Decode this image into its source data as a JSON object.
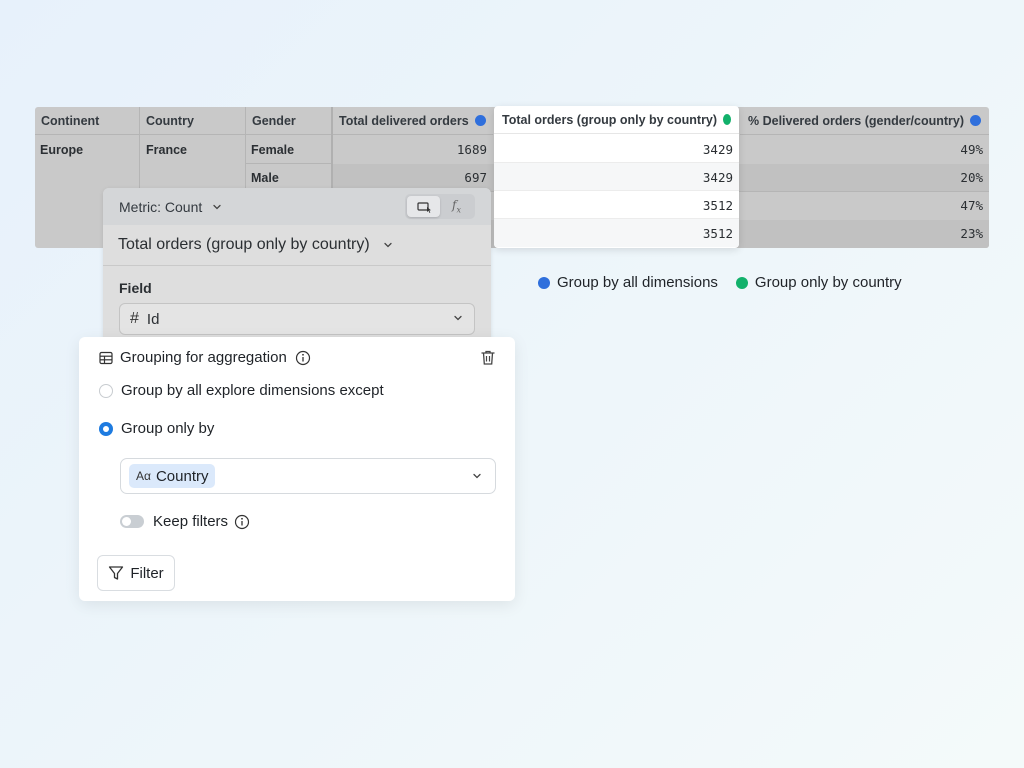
{
  "table": {
    "headers": {
      "continent": "Continent",
      "country": "Country",
      "gender": "Gender",
      "total_delivered": "Total delivered orders",
      "total_orders_country": "Total orders (group only by country)",
      "pct_delivered": "% Delivered orders (gender/country)"
    },
    "continent_value": "Europe",
    "country_value": "France",
    "genders": [
      "Female",
      "Male"
    ],
    "total_delivered_values": [
      "1689",
      "697"
    ],
    "total_orders_values": [
      "3429",
      "3429",
      "3512",
      "3512"
    ],
    "pct_values": [
      "49%",
      "20%",
      "47%",
      "23%"
    ]
  },
  "legend": {
    "all_dims": "Group by all dimensions",
    "only_country": "Group only by country"
  },
  "colors": {
    "blue_dot": "#2f6fdc",
    "green_dot": "#12b16b",
    "accent": "#1e7be0",
    "chip_bg": "#dbe9fb"
  },
  "metric_panel": {
    "metric_label": "Metric: Count",
    "title": "Total orders (group only by country)",
    "field_label": "Field",
    "field_value": "Id",
    "field_icon": "hash-icon",
    "mode_icons": [
      "table-cursor-icon",
      "function-icon"
    ]
  },
  "grouping": {
    "title": "Grouping for aggregation",
    "option_all": "Group by all explore dimensions except",
    "option_only": "Group only by",
    "selected_dimension": "Country",
    "dimension_icon_text": "Aα",
    "keep_filters": "Keep filters",
    "filter_button": "Filter"
  }
}
